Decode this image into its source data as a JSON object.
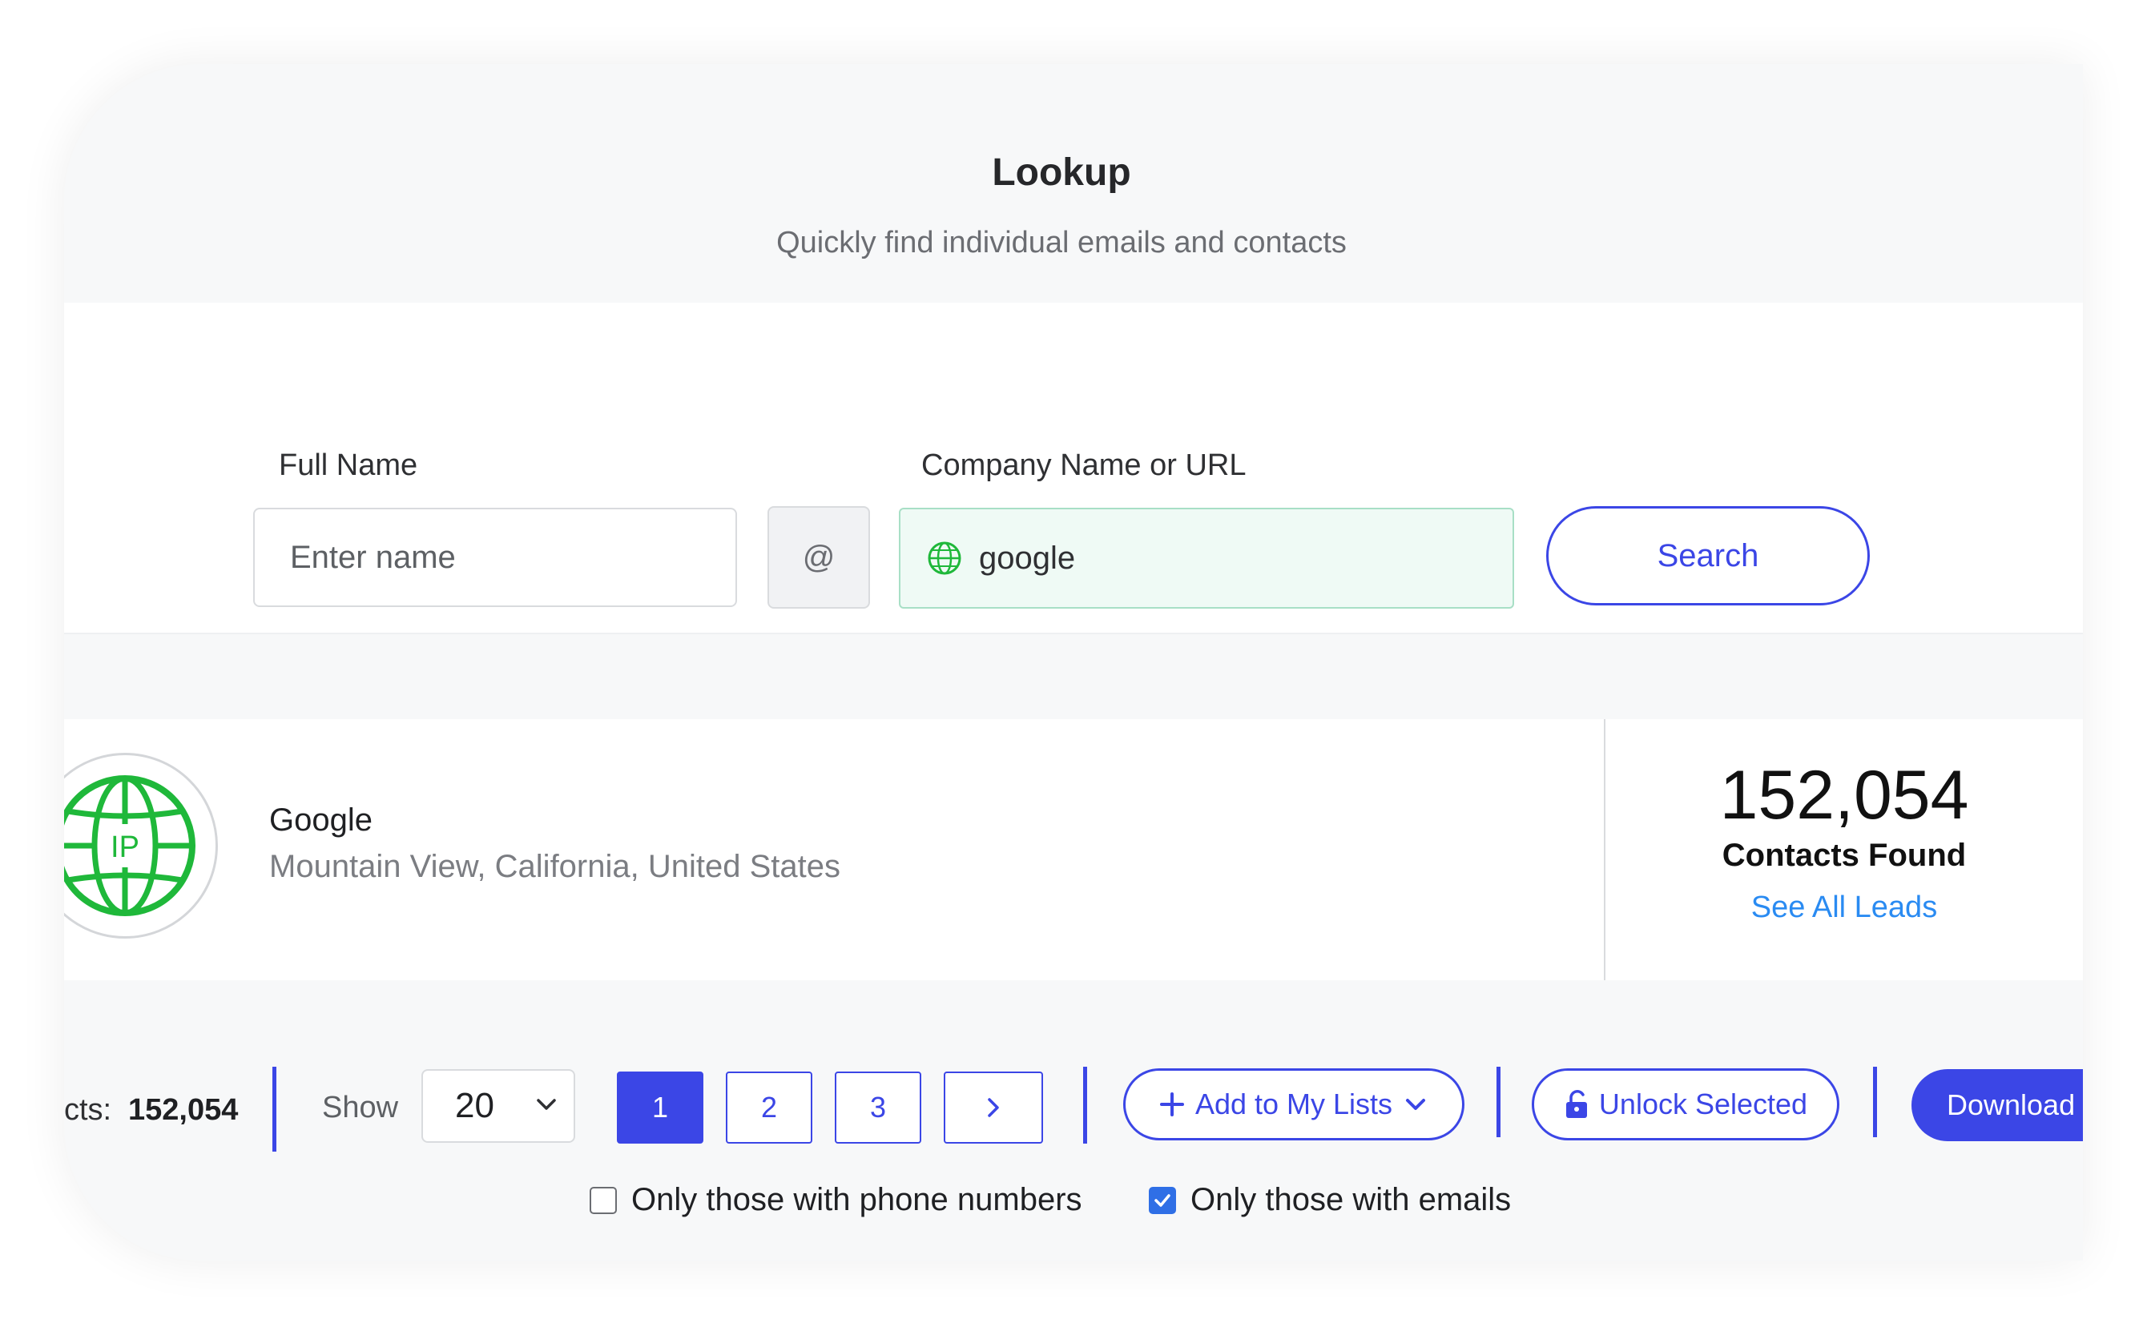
{
  "header": {
    "title": "Lookup",
    "subtitle": "Quickly find individual emails and contacts"
  },
  "search": {
    "full_name_label": "Full Name",
    "full_name_placeholder": "Enter name",
    "at_symbol": "@",
    "company_label": "Company Name or URL",
    "company_value": "google",
    "search_button": "Search"
  },
  "result": {
    "company_name": "Google",
    "location": "Mountain View, California, United States",
    "logo_text": "IP",
    "contacts_count": "152,054",
    "contacts_label": "Contacts Found",
    "see_all_link": "See All Leads"
  },
  "toolbar": {
    "total_label": "cts:",
    "total_value": "152,054",
    "show_label": "Show",
    "page_size": "20",
    "pages": [
      "1",
      "2",
      "3"
    ],
    "current_page": "1",
    "add_to_lists": "Add to My Lists",
    "unlock_selected": "Unlock Selected",
    "download": "Download"
  },
  "filters": {
    "phone_label": "Only those with phone numbers",
    "phone_checked": false,
    "email_label": "Only those with emails",
    "email_checked": true
  },
  "colors": {
    "accent": "#3b46e6",
    "link": "#2a8bf2",
    "globe_green": "#1fb83a",
    "company_input_bg": "#effaf5"
  },
  "icons": {
    "globe": "globe-icon",
    "chevron_down": "chevron-down-icon",
    "chevron_right": "chevron-right-icon",
    "plus": "plus-icon",
    "unlock": "unlock-icon",
    "checkmark": "checkmark-icon"
  }
}
